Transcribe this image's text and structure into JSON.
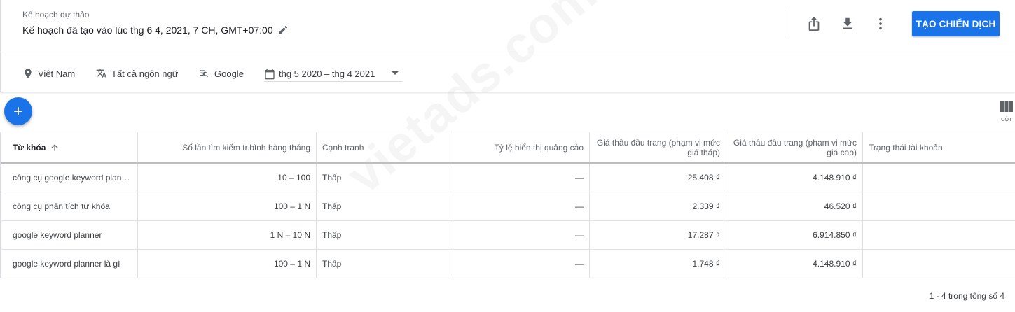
{
  "header": {
    "plan_label": "Kế hoạch dự thảo",
    "plan_title": "Kế hoạch đã tạo vào lúc thg 6 4, 2021, 7 CH, GMT+07:00",
    "create_button": "TẠO CHIẾN DỊCH",
    "icons": [
      "share-icon",
      "download-icon",
      "more-vert-icon",
      "edit-pencil-icon"
    ]
  },
  "filters": {
    "location": "Việt Nam",
    "language": "Tất cả ngôn ngữ",
    "network": "Google",
    "date_range": "thg 5 2020 – thg 4 2021"
  },
  "toolbar": {
    "columns_label": "CỘT"
  },
  "table": {
    "headers": [
      "Từ khóa",
      "Số lần tìm kiếm tr.bình hàng tháng",
      "Cạnh tranh",
      "Tỷ lệ hiển thị quảng cáo",
      "Giá thầu đầu trang (phạm vi mức giá thấp)",
      "Giá thầu đầu trang (phạm vi mức giá cao)",
      "Trạng thái tài khoản"
    ],
    "rows": [
      [
        "công cụ google keyword planner",
        "10 – 100",
        "Thấp",
        "—",
        "25.408 ₫",
        "4.148.910 ₫",
        ""
      ],
      [
        "công cụ phân tích từ khóa",
        "100 – 1 N",
        "Thấp",
        "—",
        "2.339 ₫",
        "46.520 ₫",
        ""
      ],
      [
        "google keyword planner",
        "1 N – 10 N",
        "Thấp",
        "—",
        "17.287 ₫",
        "6.914.850 ₫",
        ""
      ],
      [
        "google keyword planner là gì",
        "100 – 1 N",
        "Thấp",
        "—",
        "1.748 ₫",
        "4.148.910 ₫",
        ""
      ]
    ]
  },
  "pagination": "1 - 4 trong tổng số 4",
  "watermark": "vietads.com.vn",
  "colors": {
    "accent": "#1a73e8"
  }
}
